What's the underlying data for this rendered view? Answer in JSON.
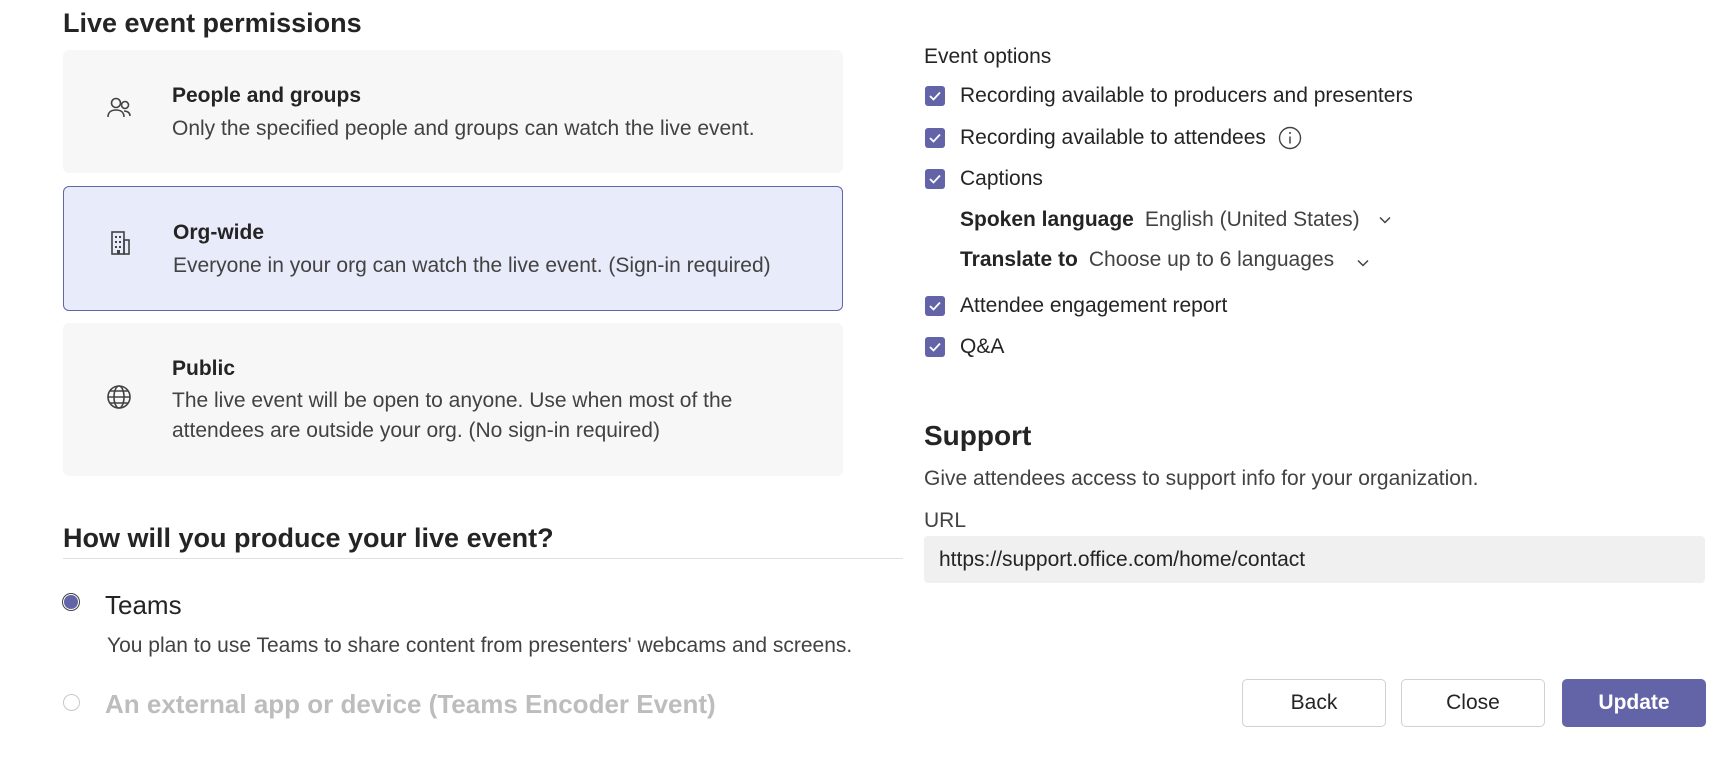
{
  "permissions": {
    "heading": "Live event permissions",
    "options": [
      {
        "title": "People and groups",
        "desc": "Only the specified people and groups can watch the live event.",
        "icon": "people-icon",
        "selected": false
      },
      {
        "title": "Org-wide",
        "desc": "Everyone in your org can watch the live event. (Sign-in required)",
        "icon": "building-icon",
        "selected": true
      },
      {
        "title": "Public",
        "desc": "The live event will be open to anyone. Use when most of the attendees are outside your org. (No sign-in required)",
        "icon": "globe-icon",
        "selected": false
      }
    ]
  },
  "production": {
    "heading": "How will you produce your live event?",
    "teams_label": "Teams",
    "teams_desc": "You plan to use Teams to share content from presenters' webcams and screens.",
    "external_label": "An external app or device (Teams Encoder Event)",
    "selected": "Teams"
  },
  "event_options": {
    "heading": "Event options",
    "recording_producers": "Recording available to producers and presenters",
    "recording_attendees": "Recording available to attendees",
    "captions": "Captions",
    "spoken_language_label": "Spoken language",
    "spoken_language_value": "English (United States)",
    "translate_label": "Translate to",
    "translate_value": "Choose up to 6 languages",
    "engagement_report": "Attendee engagement report",
    "qa": "Q&A"
  },
  "support": {
    "heading": "Support",
    "desc": "Give attendees access to support info for your organization.",
    "url_label": "URL",
    "url_value": "https://support.office.com/home/contact"
  },
  "buttons": {
    "back": "Back",
    "close": "Close",
    "update": "Update"
  },
  "colors": {
    "accent": "#6264a7",
    "selected_bg": "#e8ebfa"
  }
}
